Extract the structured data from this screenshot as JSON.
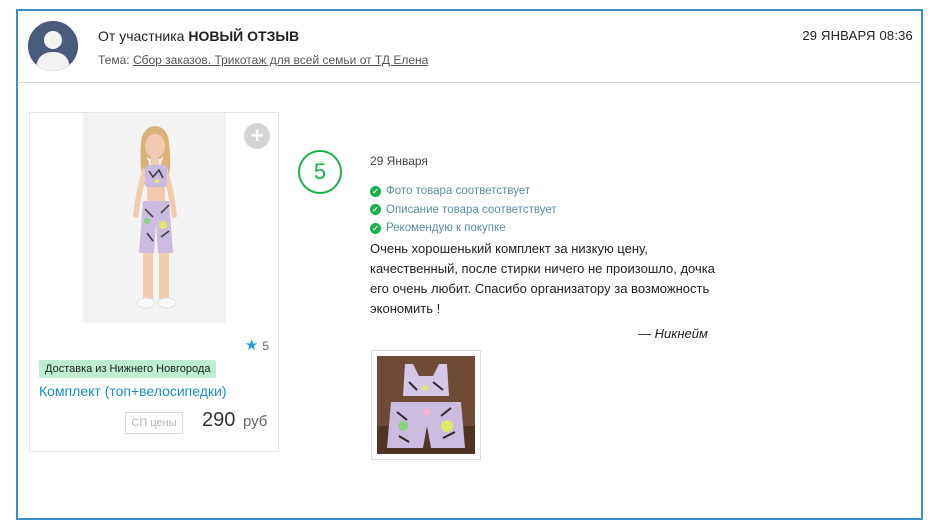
{
  "header": {
    "from_prefix": "От участника",
    "notification_type": "НОВЫЙ ОТЗЫВ",
    "topic_label": "Тема:",
    "topic_link": "Сбор заказов. Трикотаж для всей семьи от ТД Елена",
    "datetime": "29 ЯНВАРЯ 08:36"
  },
  "product": {
    "rating": "5",
    "delivery": "Доставка из Нижнего Новгорода",
    "name": "Комплект (топ+велосипедки)",
    "sp_price_label": "СП цены",
    "price": "290",
    "currency": "руб"
  },
  "review": {
    "score": "5",
    "date": "29 Января",
    "checks": [
      "Фото товара соответствует",
      "Описание товара соответствует",
      "Рекомендую к покупке"
    ],
    "text": "Очень хорошенький комплект за низкую цену, качественный, после стирки ничего не произошло, дочка его очень любит. Спасибо организатору за возможность экономить !",
    "author": "— Никнейм"
  },
  "colors": {
    "frame_border": "#3d8fc6",
    "accent_green": "#19b14a",
    "link_blue": "#1a8fd0",
    "badge_green": "#bdeed0",
    "star_blue": "#1aa3d6"
  }
}
